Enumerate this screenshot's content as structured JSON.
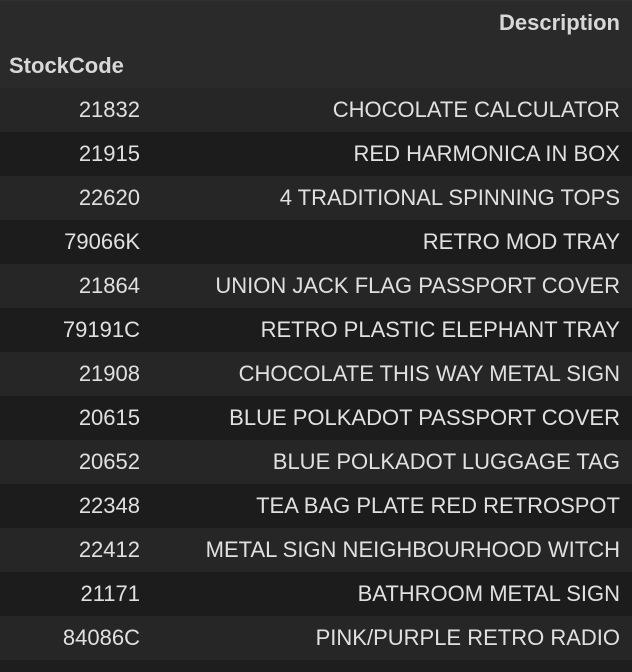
{
  "table": {
    "header_description": "Description",
    "header_stockcode": "StockCode",
    "rows": [
      {
        "code": "21832",
        "desc": "CHOCOLATE CALCULATOR"
      },
      {
        "code": "21915",
        "desc": "RED HARMONICA IN BOX"
      },
      {
        "code": "22620",
        "desc": "4 TRADITIONAL SPINNING TOPS"
      },
      {
        "code": "79066K",
        "desc": "RETRO MOD TRAY"
      },
      {
        "code": "21864",
        "desc": "UNION JACK FLAG PASSPORT COVER"
      },
      {
        "code": "79191C",
        "desc": "RETRO PLASTIC ELEPHANT TRAY"
      },
      {
        "code": "21908",
        "desc": "CHOCOLATE THIS WAY METAL SIGN"
      },
      {
        "code": "20615",
        "desc": "BLUE POLKADOT PASSPORT COVER"
      },
      {
        "code": "20652",
        "desc": "BLUE POLKADOT LUGGAGE TAG"
      },
      {
        "code": "22348",
        "desc": "TEA BAG PLATE RED RETROSPOT"
      },
      {
        "code": "22412",
        "desc": "METAL SIGN NEIGHBOURHOOD WITCH"
      },
      {
        "code": "21171",
        "desc": "BATHROOM METAL SIGN"
      },
      {
        "code": "84086C",
        "desc": "PINK/PURPLE RETRO RADIO"
      }
    ]
  }
}
